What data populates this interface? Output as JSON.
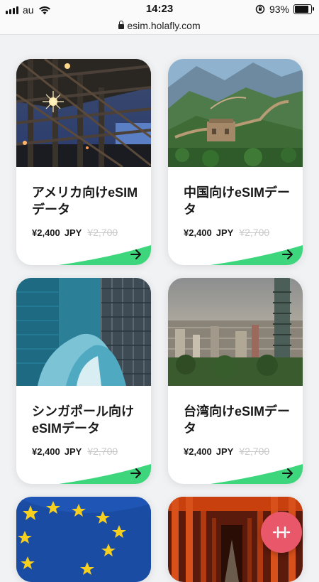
{
  "status_bar": {
    "carrier": "au",
    "time": "14:23",
    "battery": "93%"
  },
  "url_bar": {
    "url": "esim.holafly.com"
  },
  "cards": [
    {
      "title": "アメリカ向けeSIMデータ",
      "price": "¥2,400",
      "currency": "JPY",
      "old_price": "¥2,700"
    },
    {
      "title": "中国向けeSIMデータ",
      "price": "¥2,400",
      "currency": "JPY",
      "old_price": "¥2,700"
    },
    {
      "title": "シンガポール向けeSIMデータ",
      "price": "¥2,400",
      "currency": "JPY",
      "old_price": "¥2,700"
    },
    {
      "title": "台湾向けeSIMデータ",
      "price": "¥2,400",
      "currency": "JPY",
      "old_price": "¥2,700"
    }
  ],
  "colors": {
    "accent_green": "#3ed67c",
    "fab": "#e8576a"
  },
  "icons": {
    "card_arrow": "arrow-right-icon",
    "fab": "holafly-h-icon"
  }
}
